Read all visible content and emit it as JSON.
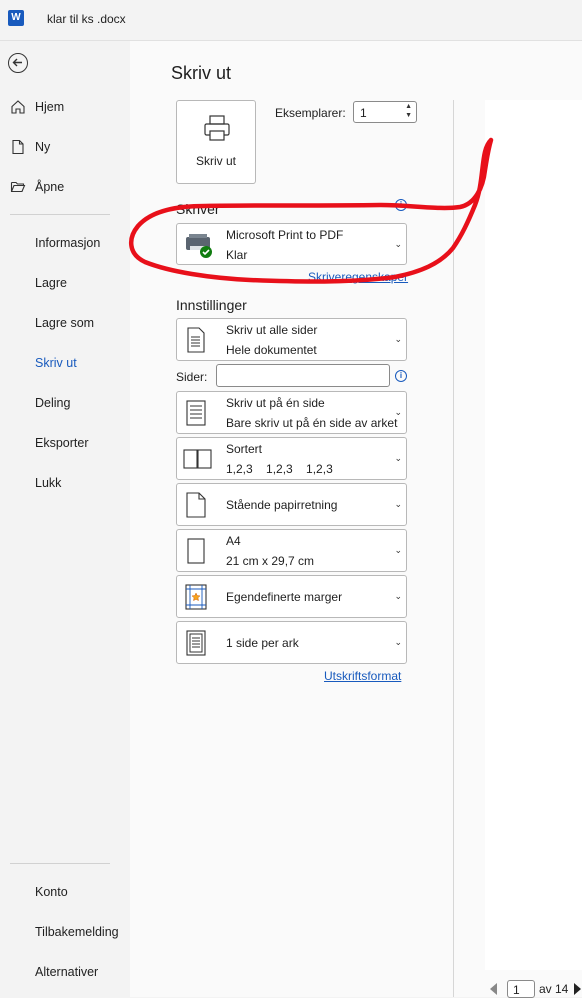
{
  "titlebar": {
    "app_icon_letter": "W",
    "document_name": "klar til ks .docx"
  },
  "nav": {
    "main_items": [
      {
        "label": "Hjem",
        "icon": "home-icon"
      },
      {
        "label": "Ny",
        "icon": "new-document-icon"
      },
      {
        "label": "Åpne",
        "icon": "folder-icon"
      }
    ],
    "sub_items": [
      {
        "label": "Informasjon"
      },
      {
        "label": "Lagre"
      },
      {
        "label": "Lagre som"
      },
      {
        "label": "Skriv ut",
        "active": true
      },
      {
        "label": "Deling"
      },
      {
        "label": "Eksporter"
      },
      {
        "label": "Lukk"
      }
    ],
    "bottom_items": [
      {
        "label": "Konto"
      },
      {
        "label": "Tilbakemelding"
      },
      {
        "label": "Alternativer"
      }
    ]
  },
  "print": {
    "title": "Skriv ut",
    "button_label": "Skriv ut",
    "copies_label": "Eksemplarer:",
    "copies_value": "1"
  },
  "printer": {
    "section_title": "Skriver",
    "name": "Microsoft Print to PDF",
    "status": "Klar",
    "properties_link": "Skriveregenskaper"
  },
  "settings": {
    "section_title": "Innstillinger",
    "pages_label": "Sider:",
    "pages_value": "",
    "items": [
      {
        "line1": "Skriv ut alle sider",
        "line2": "Hele dokumentet"
      },
      {
        "line1": "Skriv ut på én side",
        "line2": "Bare skriv ut på én side av arket"
      },
      {
        "line1": "Sortert",
        "line2": "1,2,3    1,2,3    1,2,3"
      },
      {
        "line1": "Stående papirretning",
        "line2": ""
      },
      {
        "line1": "A4",
        "line2": "21 cm x 29,7 cm"
      },
      {
        "line1": "Egendefinerte marger",
        "line2": ""
      },
      {
        "line1": "1 side per ark",
        "line2": ""
      }
    ],
    "page_setup_link": "Utskriftsformat"
  },
  "preview": {
    "current_page": "1",
    "of_label": "av 14"
  },
  "annotation": {
    "color": "#e8101a"
  }
}
